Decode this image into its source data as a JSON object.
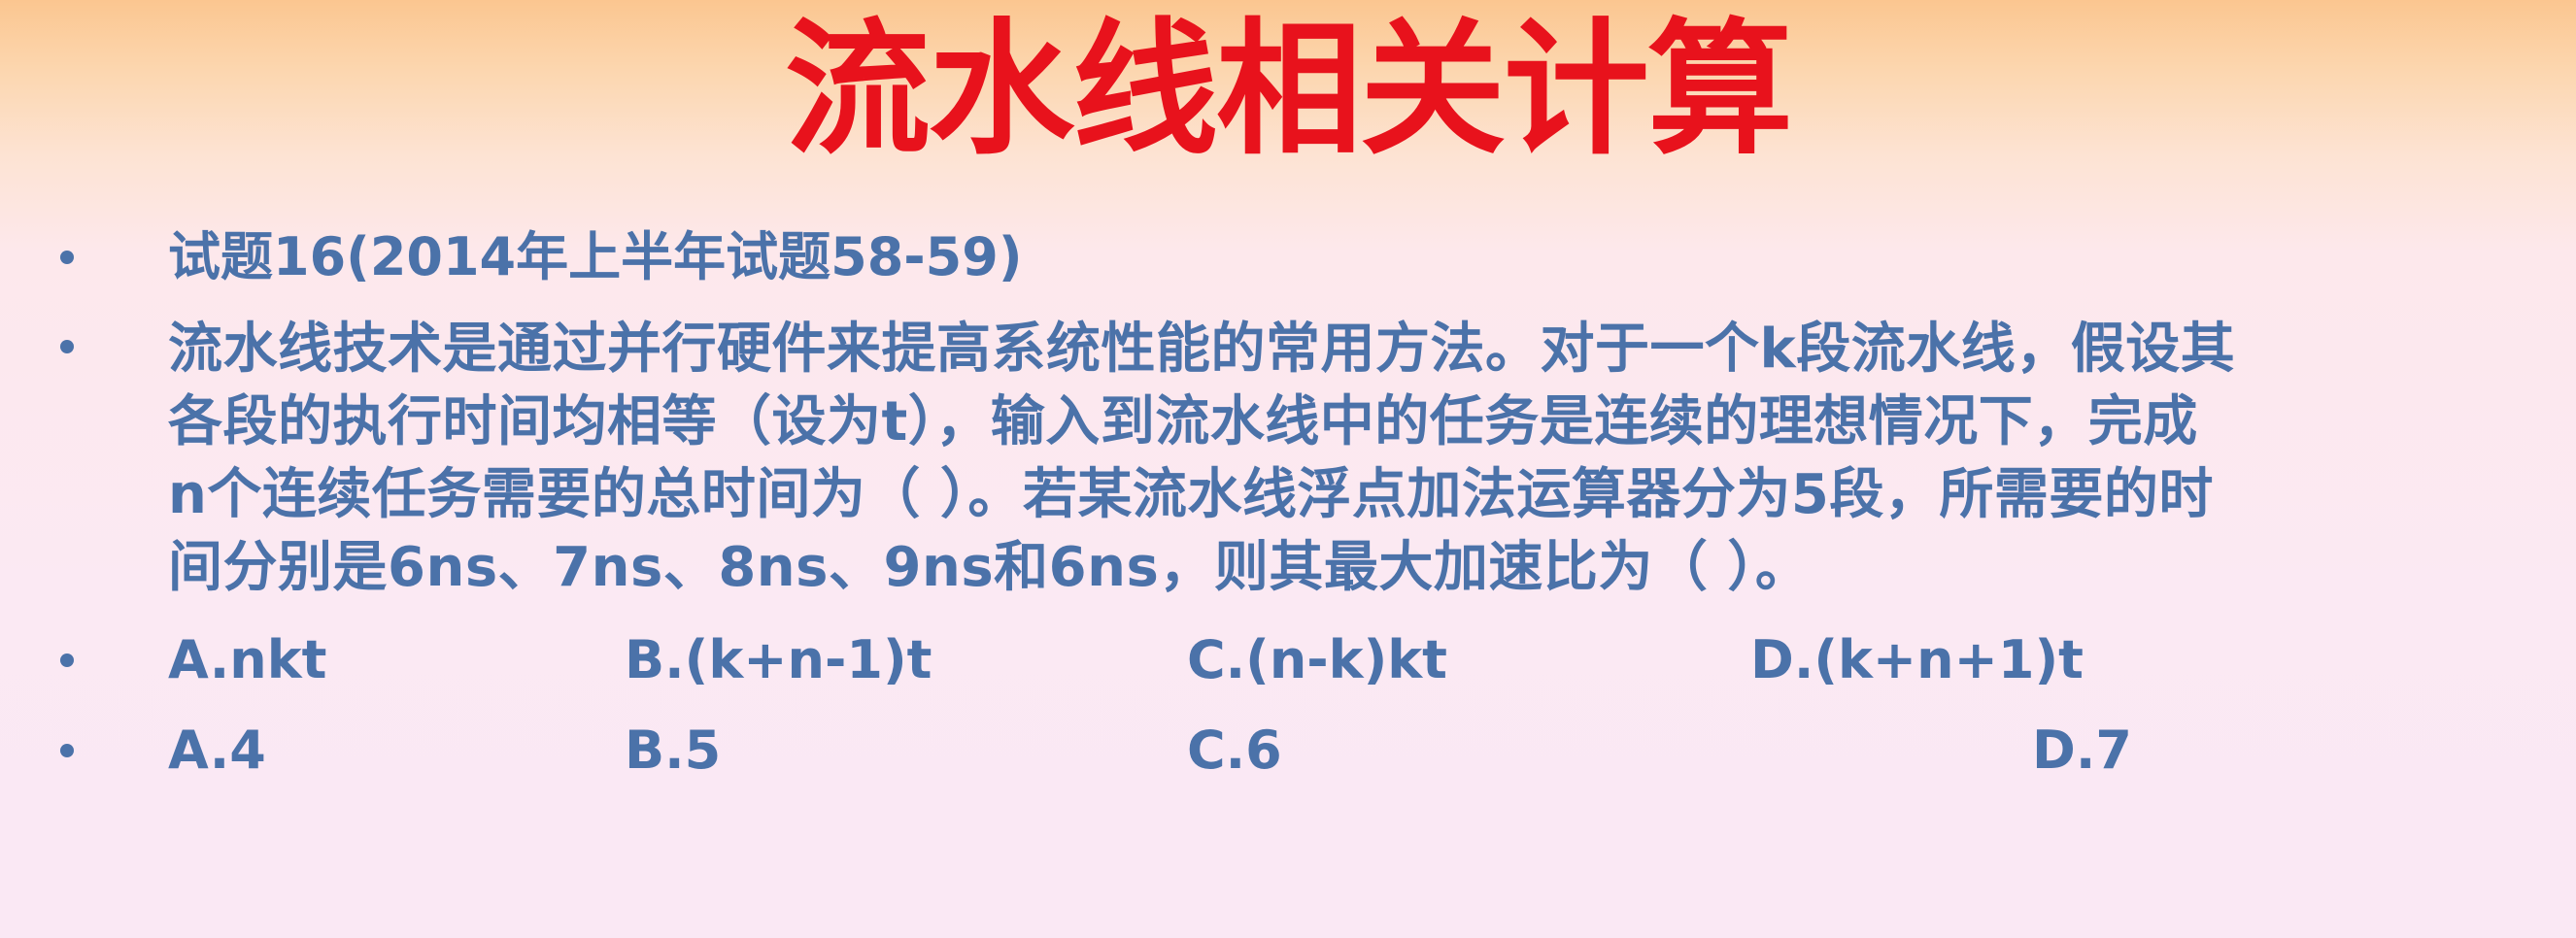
{
  "slide": {
    "title": "流水线相关计算",
    "question_header": "试题16(2014年上半年试题58-59)",
    "body_lines": [
      "流水线技术是通过并行硬件来提高系统性能的常用方法。对于一个k段流水线，假设其",
      "各段的执行时间均相等（设为t），输入到流水线中的任务是连续的理想情况下，完成",
      "n个连续任务需要的总时间为（  ）。若某流水线浮点加法运算器分为5段，所需要的时",
      "间分别是6ns、7ns、8ns、9ns和6ns，则其最大加速比为（  ）。"
    ],
    "options_1": [
      "A.nkt",
      "B.(k+n-1)t",
      "C.(n-k)kt",
      "D.(k+n+1)t"
    ],
    "options_2": [
      "A.4",
      "B.5",
      "C.6",
      "D.7"
    ]
  },
  "colors": {
    "title": "#e8121c",
    "text": "#4b72a9",
    "bg_top": "#fbc690",
    "bg_bottom": "#fae8f4"
  }
}
